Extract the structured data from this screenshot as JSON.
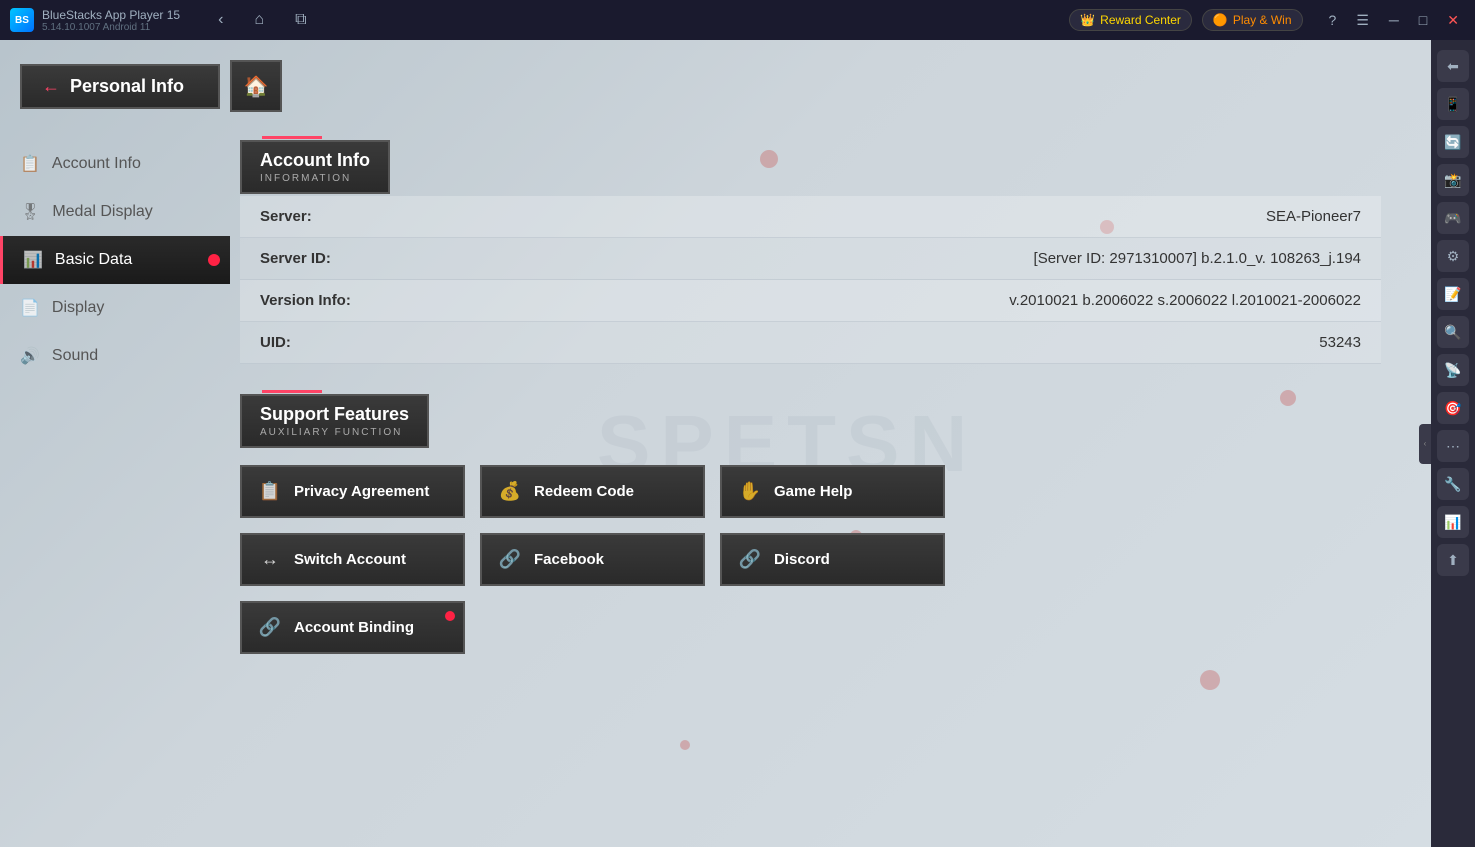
{
  "titleBar": {
    "appName": "BlueStacks App Player 15",
    "version": "5.14.10.1007  Android 11",
    "rewardCenter": "Reward Center",
    "playAndWin": "Play & Win",
    "rewardIcon": "👑",
    "playIcon": "🟠"
  },
  "header": {
    "personalInfo": "Personal Info",
    "homeBtn": "🏠",
    "backArrow": "←"
  },
  "sidebar": {
    "items": [
      {
        "id": "account-info",
        "label": "Account Info",
        "icon": "📋",
        "active": false
      },
      {
        "id": "medal-display",
        "label": "Medal Display",
        "icon": "🎖",
        "active": false
      },
      {
        "id": "basic-data",
        "label": "Basic Data",
        "icon": "📊",
        "active": true
      },
      {
        "id": "display",
        "label": "Display",
        "icon": "📄",
        "active": false
      },
      {
        "id": "sound",
        "label": "Sound",
        "icon": "🔊",
        "active": false
      }
    ]
  },
  "accountInfo": {
    "sectionTitle": "Account Info",
    "sectionSubtitle": "INFORMATION",
    "fields": [
      {
        "label": "Server:",
        "value": "SEA-Pioneer7"
      },
      {
        "label": "Server ID:",
        "value": "[Server ID: 2971310007] b.2.1.0_v. 108263_j.194"
      },
      {
        "label": "Version Info:",
        "value": "v.2010021 b.2006022 s.2006022 l.2010021-2006022"
      },
      {
        "label": "UID:",
        "value": "53243"
      }
    ]
  },
  "supportFeatures": {
    "sectionTitle": "Support Features",
    "sectionSubtitle": "AUXILIARY FUNCTION",
    "buttons": [
      {
        "id": "privacy-agreement",
        "label": "Privacy Agreement",
        "icon": "📋",
        "badge": false
      },
      {
        "id": "redeem-code",
        "label": "Redeem Code",
        "icon": "💰",
        "badge": false
      },
      {
        "id": "game-help",
        "label": "Game Help",
        "icon": "✋",
        "badge": false
      },
      {
        "id": "switch-account",
        "label": "Switch Account",
        "icon": "↔",
        "badge": false
      },
      {
        "id": "facebook",
        "label": "Facebook",
        "icon": "🔗",
        "badge": false
      },
      {
        "id": "discord",
        "label": "Discord",
        "icon": "🔗",
        "badge": false
      },
      {
        "id": "account-binding",
        "label": "Account Binding",
        "icon": "🔗",
        "badge": true
      }
    ]
  },
  "watermark": "SPETSN",
  "rightTools": [
    "⬅",
    "📱",
    "🔄",
    "📸",
    "🎮",
    "⚙",
    "📝",
    "🔍",
    "📡",
    "🎯",
    "⋯",
    "🔧",
    "📊",
    "⬆"
  ]
}
